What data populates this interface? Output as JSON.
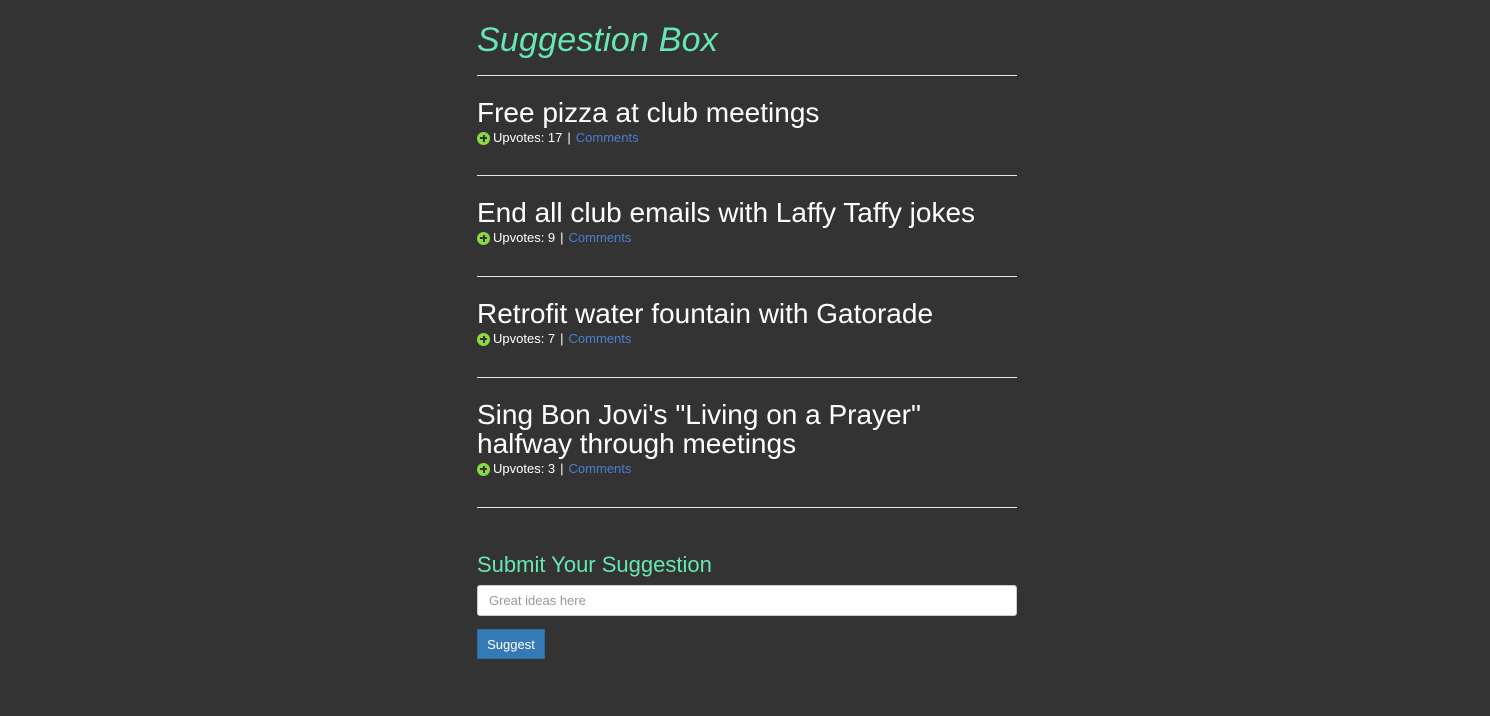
{
  "page": {
    "title": "Suggestion Box",
    "accent_color": "#66e6b4",
    "background_color": "#333333"
  },
  "suggestions": [
    {
      "title": "Free pizza at club meetings",
      "upvotes_label": "Upvotes: 17",
      "separator": "|",
      "comments_label": "Comments"
    },
    {
      "title": "End all club emails with Laffy Taffy jokes",
      "upvotes_label": "Upvotes: 9",
      "separator": "|",
      "comments_label": "Comments"
    },
    {
      "title": "Retrofit water fountain with Gatorade",
      "upvotes_label": "Upvotes: 7",
      "separator": "|",
      "comments_label": "Comments"
    },
    {
      "title": "Sing Bon Jovi's \"Living on a Prayer\" halfway through meetings",
      "upvotes_label": "Upvotes: 3",
      "separator": "|",
      "comments_label": "Comments"
    }
  ],
  "icons": {
    "upvote": "plus-circle-icon",
    "upvote_color": "#8bd940"
  },
  "form": {
    "heading": "Submit Your Suggestion",
    "input_value": "",
    "input_placeholder": "Great ideas here",
    "button_label": "Suggest",
    "button_color": "#337ab7"
  }
}
